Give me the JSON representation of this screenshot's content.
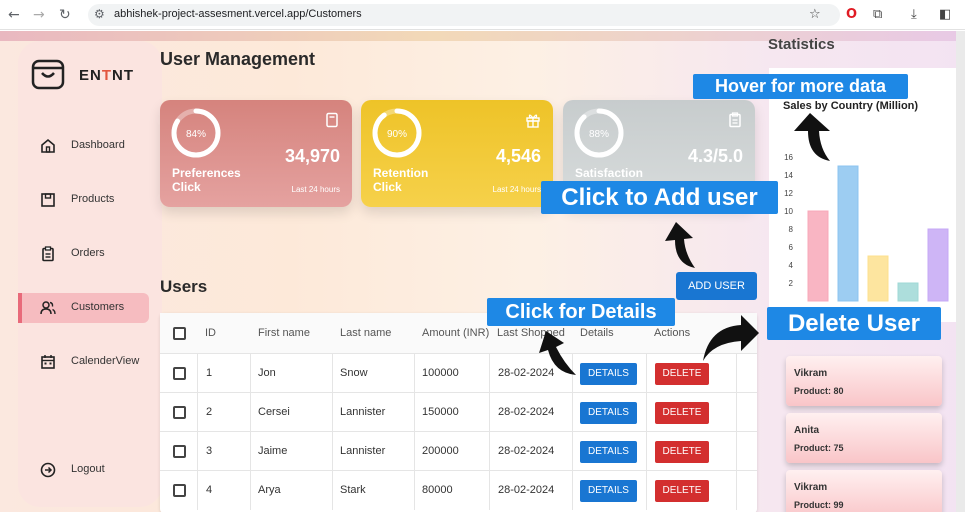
{
  "browser": {
    "url": "abhishek-project-assesment.vercel.app/Customers"
  },
  "brand": {
    "part1": "EN",
    "part2": "T",
    "part3": "NT"
  },
  "sidebar": {
    "items": [
      {
        "label": "Dashboard",
        "icon": "home-icon"
      },
      {
        "label": "Products",
        "icon": "products-icon"
      },
      {
        "label": "Orders",
        "icon": "orders-icon"
      },
      {
        "label": "Customers",
        "icon": "customers-icon",
        "active": true
      },
      {
        "label": "CalenderView",
        "icon": "calendar-icon"
      }
    ],
    "logout": "Logout"
  },
  "page_title": "User Management",
  "cards": [
    {
      "percent": "84%",
      "value": "34,970",
      "title_line1": "Preferences",
      "title_line2": "Click",
      "sub": "Last 24 hours",
      "progress": 0.84,
      "icon": "book-icon"
    },
    {
      "percent": "90%",
      "value": "4,546",
      "title_line1": "Retention",
      "title_line2": "Click",
      "sub": "Last 24 hours",
      "progress": 0.9,
      "icon": "gift-icon"
    },
    {
      "percent": "88%",
      "value": "4.3/5.0",
      "title_line1": "Satisfaction",
      "title_line2": "",
      "sub": "",
      "progress": 0.88,
      "icon": "clipboard-icon"
    }
  ],
  "users": {
    "title": "Users",
    "add_button": "ADD USER",
    "columns": [
      "ID",
      "First name",
      "Last name",
      "Amount (INR)",
      "Last Shopped",
      "Details",
      "Actions"
    ],
    "rows": [
      {
        "id": "1",
        "first": "Jon",
        "last": "Snow",
        "amount": "100000",
        "date": "28-02-2024"
      },
      {
        "id": "2",
        "first": "Cersei",
        "last": "Lannister",
        "amount": "150000",
        "date": "28-02-2024"
      },
      {
        "id": "3",
        "first": "Jaime",
        "last": "Lannister",
        "amount": "200000",
        "date": "28-02-2024"
      },
      {
        "id": "4",
        "first": "Arya",
        "last": "Stark",
        "amount": "80000",
        "date": "28-02-2024"
      }
    ],
    "details_label": "DETAILS",
    "delete_label": "DELETE"
  },
  "statistics": {
    "title": "Statistics"
  },
  "chart_data": {
    "type": "bar",
    "title": "Sales by Country (Million)",
    "values": [
      10,
      15,
      5,
      2,
      8
    ],
    "colors": [
      "#f8a8b8",
      "#8cc4f0",
      "#fde08e",
      "#9fd8d6",
      "#c6a8f5"
    ],
    "y_ticks": [
      "2",
      "4",
      "6",
      "8",
      "10",
      "12",
      "14",
      "16"
    ],
    "ylim": [
      0,
      17
    ]
  },
  "top_users": [
    {
      "name": "Vikram",
      "product": "Product: 80"
    },
    {
      "name": "Anita",
      "product": "Product: 75"
    },
    {
      "name": "Vikram",
      "product": "Product: 99"
    }
  ],
  "annotations": {
    "hover": "Hover for more data",
    "add": "Click to Add user",
    "details": "Click for Details",
    "delete": "Delete User"
  }
}
